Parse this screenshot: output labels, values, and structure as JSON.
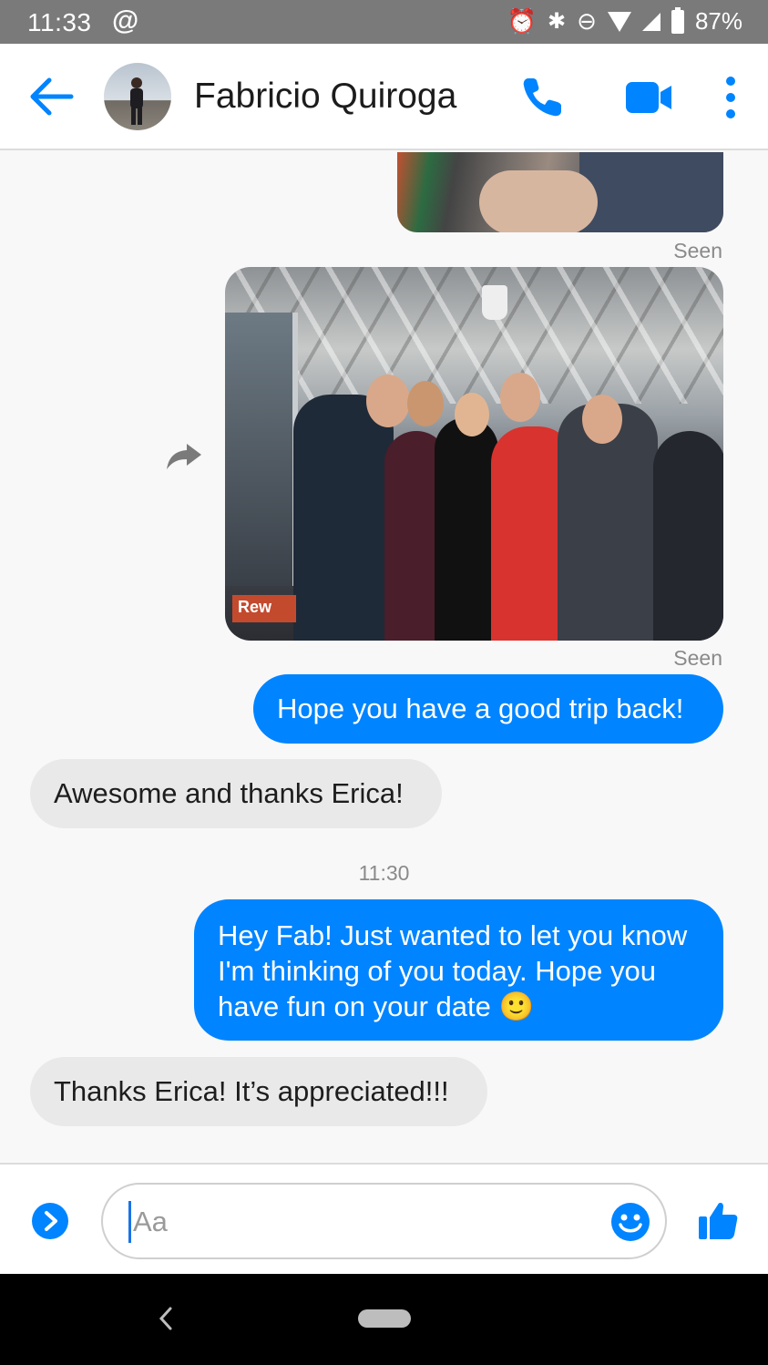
{
  "status_bar": {
    "time": "11:33",
    "battery": "87%",
    "icons": [
      "at-sign-icon",
      "alarm-icon",
      "bluetooth-icon",
      "do-not-disturb-icon",
      "wifi-icon",
      "signal-icon",
      "battery-icon"
    ]
  },
  "header": {
    "contact_name": "Fabricio Quiroga",
    "accent_color": "#0084ff"
  },
  "messages": {
    "seen_1": "Seen",
    "seen_2": "Seen",
    "out_1": "Hope you have a good trip back!",
    "in_1": "Awesome and thanks Erica!",
    "timestamp": "11:30",
    "out_2": "Hey Fab! Just wanted to let you know I'm thinking of you today. Hope you have fun on your date 🙂",
    "in_2": "Thanks Erica! It’s appreciated!!!"
  },
  "composer": {
    "placeholder": "Aa"
  },
  "photo2": {
    "sign_text": "Rew"
  }
}
